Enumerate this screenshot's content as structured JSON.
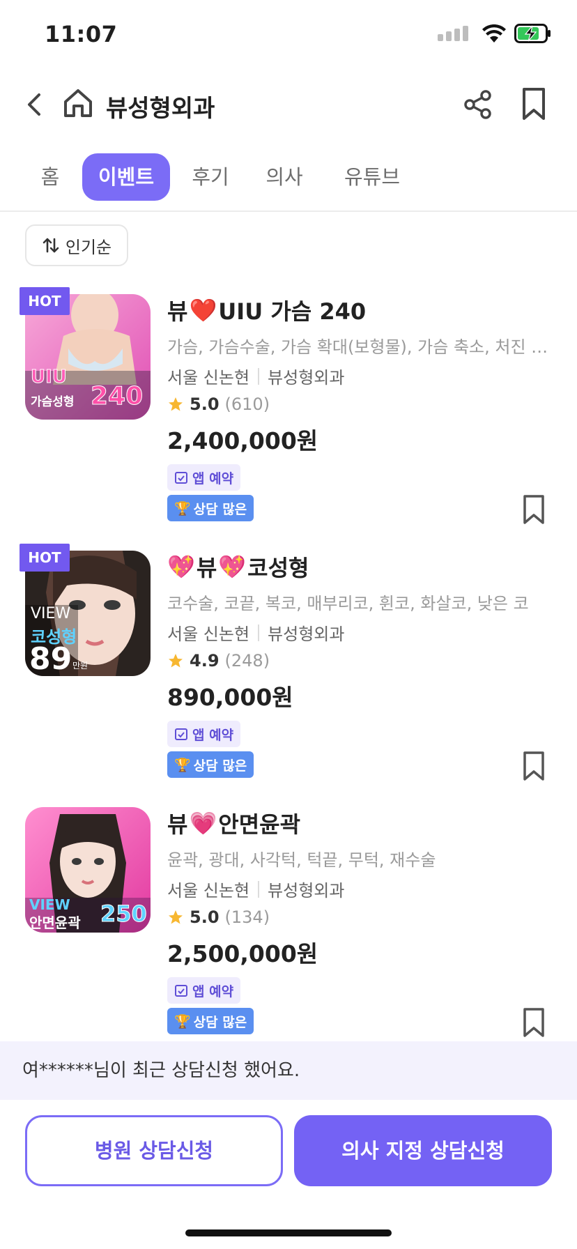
{
  "status": {
    "time": "11:07"
  },
  "header": {
    "title": "뷰성형외과"
  },
  "tabs": [
    "홈",
    "이벤트",
    "후기",
    "의사",
    "유튜브"
  ],
  "active_tab": "이벤트",
  "sort": {
    "label": "인기순"
  },
  "events": [
    {
      "hot": "HOT",
      "title_prefix": "뷰",
      "emoji1": "❤️",
      "emoji2": "",
      "title_suffix": "UIU 가슴 240",
      "tags": "가슴, 가슴수술, 가슴 확대(보형물), 가슴 축소, 처진 가슴",
      "location": "서울 신논현",
      "clinic": "뷰성형외과",
      "rating": "5.0",
      "review_count": "(610)",
      "price": "2,400,000원",
      "chip_app": "앱 예약",
      "chip_consult": "상담 많은",
      "thumb": {
        "line1": "UIU",
        "line2": "가슴성형",
        "number": "240"
      }
    },
    {
      "hot": "HOT",
      "title_prefix": "",
      "emoji1": "💖",
      "emoji2": "💖",
      "title_suffix": "코성형",
      "title_mid": "뷰",
      "tags": "코수술, 코끝, 복코, 매부리코, 휜코, 화살코, 낮은 코",
      "location": "서울 신논현",
      "clinic": "뷰성형외과",
      "rating": "4.9",
      "review_count": "(248)",
      "price": "890,000원",
      "chip_app": "앱 예약",
      "chip_consult": "상담 많은",
      "thumb": {
        "line1": "VIEW",
        "line2": "코성형",
        "number": "89",
        "unit": "만원"
      }
    },
    {
      "hot": "",
      "title_prefix": "뷰",
      "emoji1": "💗",
      "emoji2": "",
      "title_suffix": "안면윤곽",
      "tags": "윤곽, 광대, 사각턱, 턱끝, 무턱, 재수술",
      "location": "서울 신논현",
      "clinic": "뷰성형외과",
      "rating": "5.0",
      "review_count": "(134)",
      "price": "2,500,000원",
      "chip_app": "앱 예약",
      "chip_consult": "상담 많은",
      "thumb": {
        "line1": "VIEW",
        "line2": "안면윤곽",
        "number": "250"
      }
    }
  ],
  "notice": "여******님이 최근 상담신청 했어요.",
  "buttons": {
    "hospital_consult": "병원 상담신청",
    "doctor_consult": "의사 지정 상담신청"
  },
  "colors": {
    "accent": "#7b6cf6",
    "chip_blue": "#5a8ff0",
    "star": "#f7b731",
    "thumb_pink": "#f06cc0"
  }
}
